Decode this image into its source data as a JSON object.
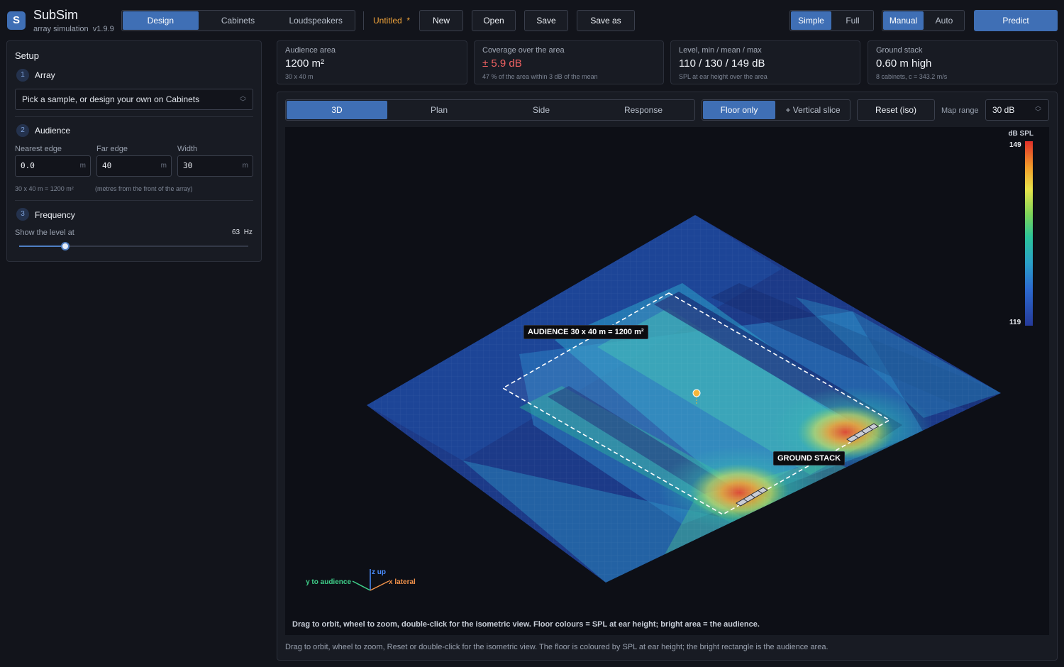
{
  "app": {
    "name": "SubSim",
    "subtitle": "array simulation",
    "version": "v1.9.9",
    "logo_letter": "S"
  },
  "tabs": [
    {
      "label": "Design",
      "active": true
    },
    {
      "label": "Cabinets",
      "active": false
    },
    {
      "label": "Loudspeakers",
      "active": false
    }
  ],
  "document": {
    "title": "Untitled",
    "modified_marker": "*"
  },
  "file_buttons": {
    "new": "New",
    "open": "Open",
    "save": "Save",
    "save_as": "Save as"
  },
  "mode": {
    "simple": "Simple",
    "full": "Full",
    "active": "Simple"
  },
  "control": {
    "manual": "Manual",
    "auto": "Auto",
    "active": "Manual"
  },
  "predict_label": "Predict",
  "setup": {
    "title": "Setup",
    "array": {
      "step": "1",
      "label": "Array",
      "select_value": "Pick a sample, or design your own on Cabinets"
    },
    "audience": {
      "step": "2",
      "label": "Audience",
      "nearest_label": "Nearest edge",
      "nearest_value": "0.0",
      "nearest_unit": "m",
      "far_label": "Far edge",
      "far_value": "40",
      "far_unit": "m",
      "width_label": "Width",
      "width_value": "30",
      "width_unit": "m",
      "summary": "30 x 40 m  =  1200 m²",
      "note": "(metres from the front of the array)"
    },
    "frequency": {
      "step": "3",
      "label": "Frequency",
      "show_label": "Show the level at",
      "value": "63",
      "unit": "Hz",
      "slider_fraction": 0.2
    }
  },
  "stats": [
    {
      "label": "Audience area",
      "value": "1200 m²",
      "note": "30 x 40 m",
      "alert": false
    },
    {
      "label": "Coverage over the area",
      "value": "± 5.9 dB",
      "note": "47 % of the area within 3 dB of the mean",
      "alert": true
    },
    {
      "label": "Level, min / mean / max",
      "value": "110 / 130 / 149 dB",
      "note": "SPL at ear height over the area",
      "alert": false
    },
    {
      "label": "Ground stack",
      "value": "0.60 m high",
      "note": "8 cabinets, c = 343.2 m/s",
      "alert": false
    }
  ],
  "view_tabs": [
    {
      "label": "3D",
      "active": true
    },
    {
      "label": "Plan",
      "active": false
    },
    {
      "label": "Side",
      "active": false
    },
    {
      "label": "Response",
      "active": false
    }
  ],
  "slice": {
    "floor_only": "Floor only",
    "vertical": "+ Vertical slice",
    "active": "Floor only"
  },
  "reset_label": "Reset (iso)",
  "map_range": {
    "label": "Map range",
    "value": "30 dB"
  },
  "viewport": {
    "audience_tag": "AUDIENCE  30 x 40 m  =  1200 m²",
    "stack_tag": "GROUND STACK",
    "legend": {
      "title": "dB SPL",
      "max": "149",
      "min": "119"
    },
    "axes": {
      "y": "y to audience",
      "z": "z up",
      "x": "x lateral"
    },
    "hint": "Drag to orbit, wheel to zoom, double-click for the isometric view.  Floor colours = SPL at ear height; bright area = the audience."
  },
  "footer_hint": "Drag to orbit, wheel to zoom, Reset or double-click for the isometric view. The floor is coloured by SPL at ear height; the bright rectangle is the audience area.",
  "colors": {
    "accent": "#3f6fb5",
    "warning": "#f0a33a",
    "alert": "#f06262",
    "background": "#12141b"
  }
}
